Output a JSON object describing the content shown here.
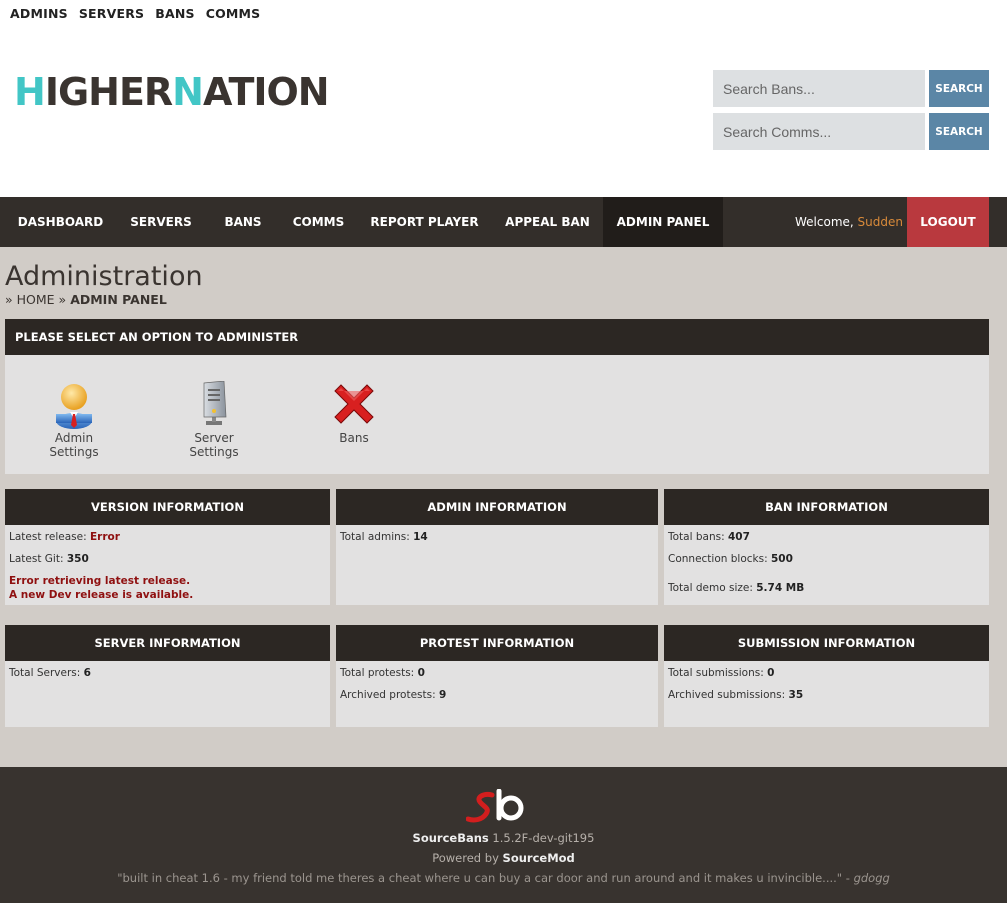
{
  "toplinks": [
    "ADMINS",
    "SERVERS",
    "BANS",
    "COMMS"
  ],
  "logo": {
    "parts": [
      "H",
      "IGHER",
      "N",
      "ATION"
    ]
  },
  "search": {
    "bans_placeholder": "Search Bans...",
    "comms_placeholder": "Search Comms...",
    "button_label": "SEARCH"
  },
  "nav": {
    "items": [
      "DASHBOARD",
      "SERVERS",
      "BANS",
      "COMMS",
      "REPORT PLAYER",
      "APPEAL BAN",
      "ADMIN PANEL"
    ],
    "active": "ADMIN PANEL",
    "welcome_prefix": "Welcome,",
    "username": "Sudden",
    "logout": "LOGOUT"
  },
  "page": {
    "title": "Administration",
    "breadcrumb": {
      "sep": "»",
      "home": "HOME",
      "current": "ADMIN PANEL"
    }
  },
  "options": {
    "heading": "PLEASE SELECT AN OPTION TO ADMINISTER",
    "items": [
      {
        "label": "Admin Settings",
        "icon": "admin-user-icon"
      },
      {
        "label": "Server Settings",
        "icon": "server-icon"
      },
      {
        "label": "Bans",
        "icon": "red-x-icon"
      }
    ]
  },
  "version_info": {
    "heading": "VERSION INFORMATION",
    "latest_release_label": "Latest release:",
    "latest_release_value": "Error",
    "latest_git_label": "Latest Git:",
    "latest_git_value": "350",
    "error_msg": "Error retrieving latest release.",
    "dev_msg": "A new Dev release is available."
  },
  "admin_info": {
    "heading": "ADMIN INFORMATION",
    "total_admins_label": "Total admins:",
    "total_admins_value": "14"
  },
  "ban_info": {
    "heading": "BAN INFORMATION",
    "total_bans_label": "Total bans:",
    "total_bans_value": "407",
    "conn_blocks_label": "Connection blocks:",
    "conn_blocks_value": "500",
    "demo_size_label": "Total demo size:",
    "demo_size_value": "5.74 MB"
  },
  "server_info": {
    "heading": "SERVER INFORMATION",
    "total_servers_label": "Total Servers:",
    "total_servers_value": "6"
  },
  "protest_info": {
    "heading": "PROTEST INFORMATION",
    "total_label": "Total protests:",
    "total_value": "0",
    "archived_label": "Archived protests:",
    "archived_value": "9"
  },
  "submission_info": {
    "heading": "SUBMISSION INFORMATION",
    "total_label": "Total submissions:",
    "total_value": "0",
    "archived_label": "Archived submissions:",
    "archived_value": "35"
  },
  "footer": {
    "product": "SourceBans",
    "version": "1.5.2F-dev-git195",
    "powered_prefix": "Powered by",
    "powered_by": "SourceMod",
    "quote": "\"built in cheat 1.6 - my friend told me theres a cheat where u can buy a car door and run around and it makes u invincible....\"",
    "quote_sep": "-",
    "quote_author": "gdogg"
  },
  "colors": {
    "nav_bg": "#332e2a",
    "logout_bg": "#b9393e",
    "search_btn": "#5b86a6",
    "logo_accent": "#42c6c6",
    "error_red": "#8f1010"
  }
}
